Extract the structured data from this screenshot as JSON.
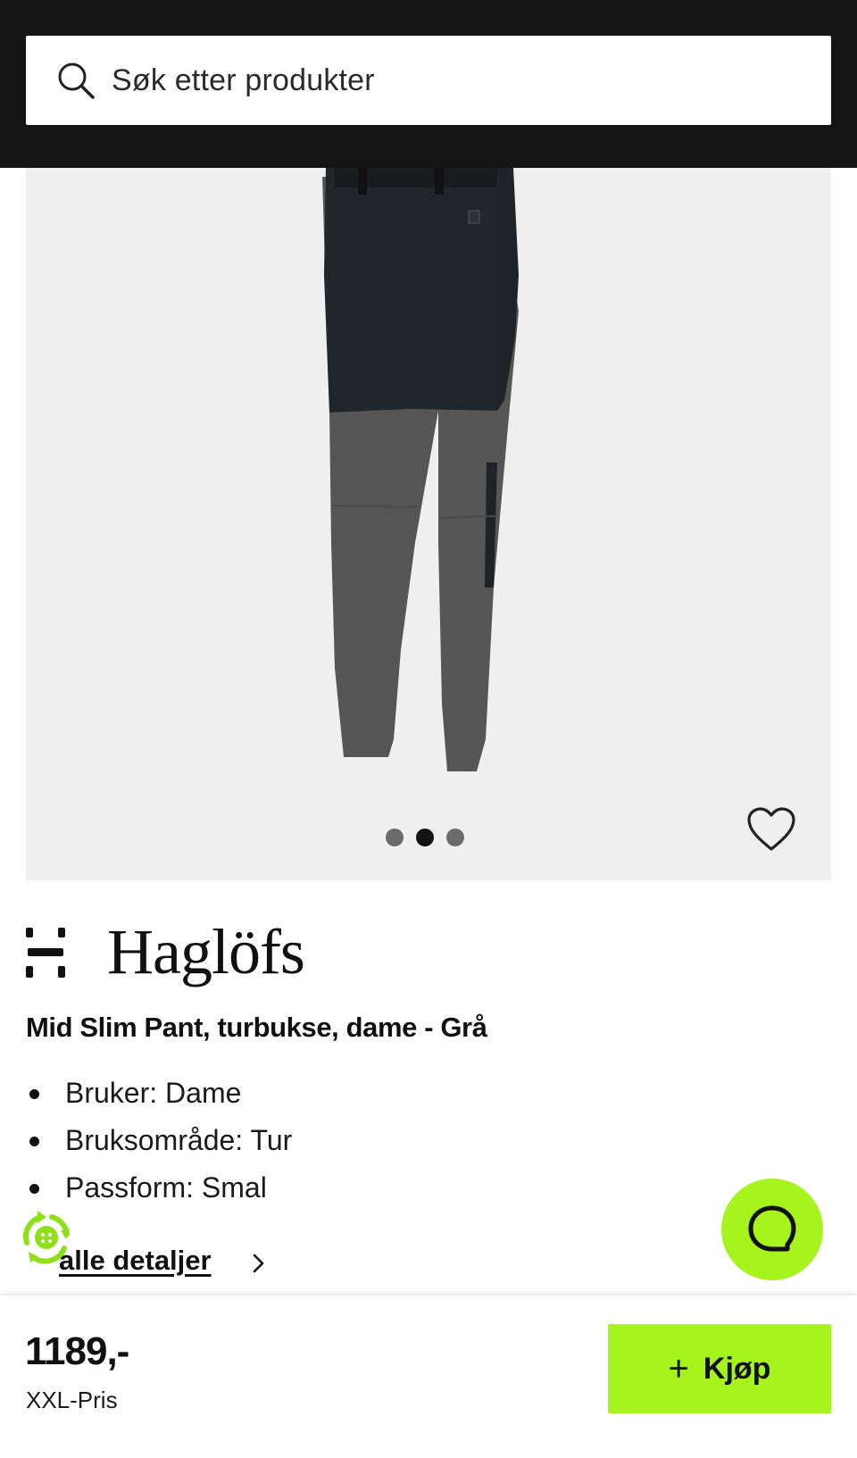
{
  "search": {
    "placeholder": "Søk etter produkter"
  },
  "gallery": {
    "image_count": 3,
    "active_index": 1
  },
  "product": {
    "brand": "Haglöfs",
    "title": "Mid Slim Pant, turbukse, dame - Grå",
    "features": [
      "Bruker: Dame",
      "Bruksområde: Tur",
      "Passform: Smal"
    ],
    "details_link": "alle detaljer"
  },
  "footer": {
    "price": "1189,-",
    "price_label": "XXL-Pris",
    "buy_label": "Kjøp",
    "buy_icon": "plus-icon"
  },
  "colors": {
    "accent": "#a6f31e",
    "header_bg": "#141414",
    "gallery_bg": "#efefef"
  },
  "icons": [
    "search-icon",
    "heart-icon",
    "haglofs-logo-icon",
    "eco-badge-icon",
    "chat-icon",
    "chevron-right-icon",
    "plus-icon"
  ]
}
